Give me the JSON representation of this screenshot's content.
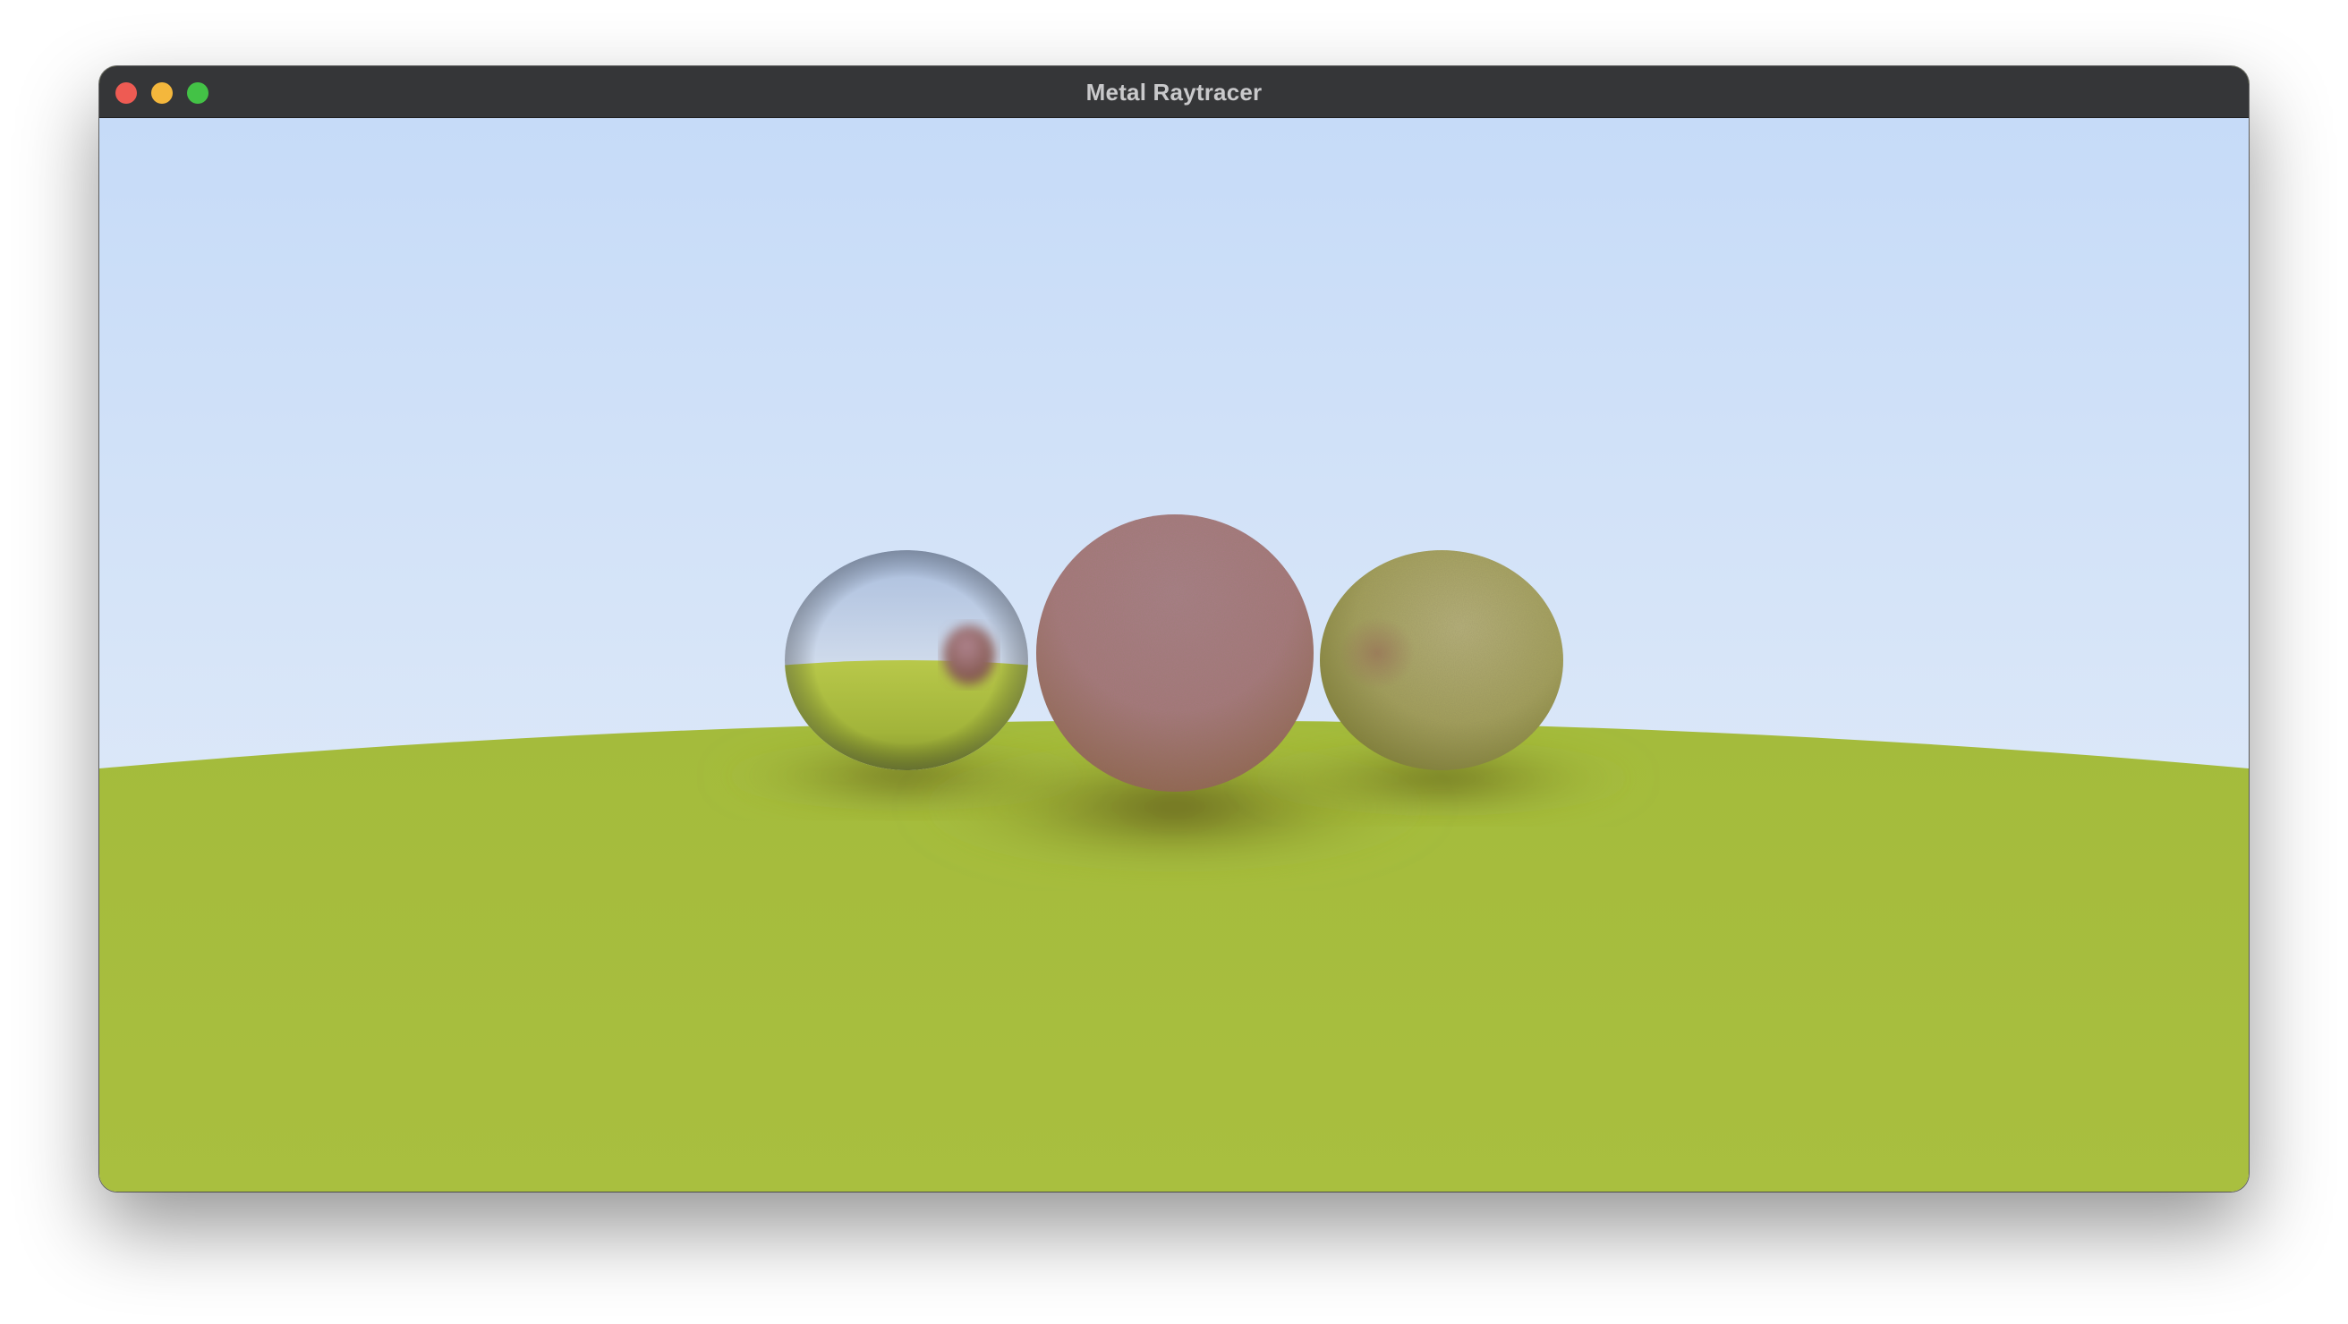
{
  "window": {
    "title": "Metal Raytracer",
    "controls": {
      "close_color": "#ee5b53",
      "minimize_color": "#f4b73c",
      "zoom_color": "#43c246"
    }
  },
  "scene": {
    "sky_top_color": "#c6dbf8",
    "sky_horizon_color": "#e8eff9",
    "ground_color": "#a9bf3f",
    "spheres": [
      {
        "name": "metal-sphere",
        "material": "mirror",
        "color": "#c7d2dd"
      },
      {
        "name": "diffuse-sphere",
        "material": "diffuse",
        "color": "#a87a86"
      },
      {
        "name": "fuzzy-metal-sphere",
        "material": "fuzzy-metal",
        "color": "#b4ae72"
      }
    ]
  }
}
